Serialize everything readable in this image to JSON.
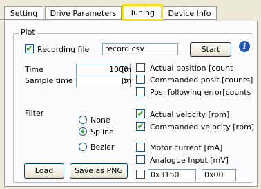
{
  "tabs": [
    {
      "label": "Setting"
    },
    {
      "label": "Drive Parameters"
    },
    {
      "label": "Tuning"
    },
    {
      "label": "Device Info"
    }
  ],
  "plot": {
    "group_label": "Plot",
    "recording_file": {
      "label": "Recording file",
      "checked": true,
      "value": "record.csv"
    },
    "start_label": "Start",
    "time_label": "Time",
    "time_value": "1000",
    "time_unit": "[ms]",
    "sample_time_label": "Sample time",
    "sample_time_value": "5",
    "sample_time_unit": "[ms]",
    "filter_label": "Filter",
    "filter_options": [
      {
        "label": "None",
        "selected": false
      },
      {
        "label": "Spline",
        "selected": true
      },
      {
        "label": "Bezier",
        "selected": false
      }
    ],
    "signals": [
      {
        "label": "Actual position [count",
        "checked": false
      },
      {
        "label": "Commanded posit.[counts]",
        "checked": false
      },
      {
        "label": "Pos. following error[counts",
        "checked": false
      },
      {
        "label": "Actual velocity [rpm]",
        "checked": true
      },
      {
        "label": "Commanded velocity [rpm]",
        "checked": true
      },
      {
        "label": "Motor current [mA]",
        "checked": false
      },
      {
        "label": "Analogue Input [mV]",
        "checked": false
      }
    ],
    "custom": {
      "checked": false,
      "address": "0x3150",
      "subindex": "0x00"
    },
    "load_label": "Load",
    "save_png_label": "Save as PNG"
  }
}
